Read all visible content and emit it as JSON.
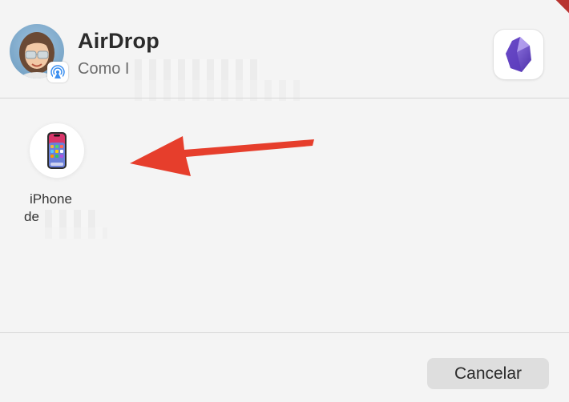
{
  "header": {
    "title": "AirDrop",
    "subtitle": "Como I"
  },
  "app": {
    "icon": "obsidian-app-icon",
    "accent": "#6c4ec7"
  },
  "device": {
    "name_line1": "iPhone",
    "name_line2": "de",
    "icon": "iphone-icon"
  },
  "annotation": {
    "arrow_color": "#e63e2c"
  },
  "footer": {
    "cancel_label": "Cancelar"
  }
}
